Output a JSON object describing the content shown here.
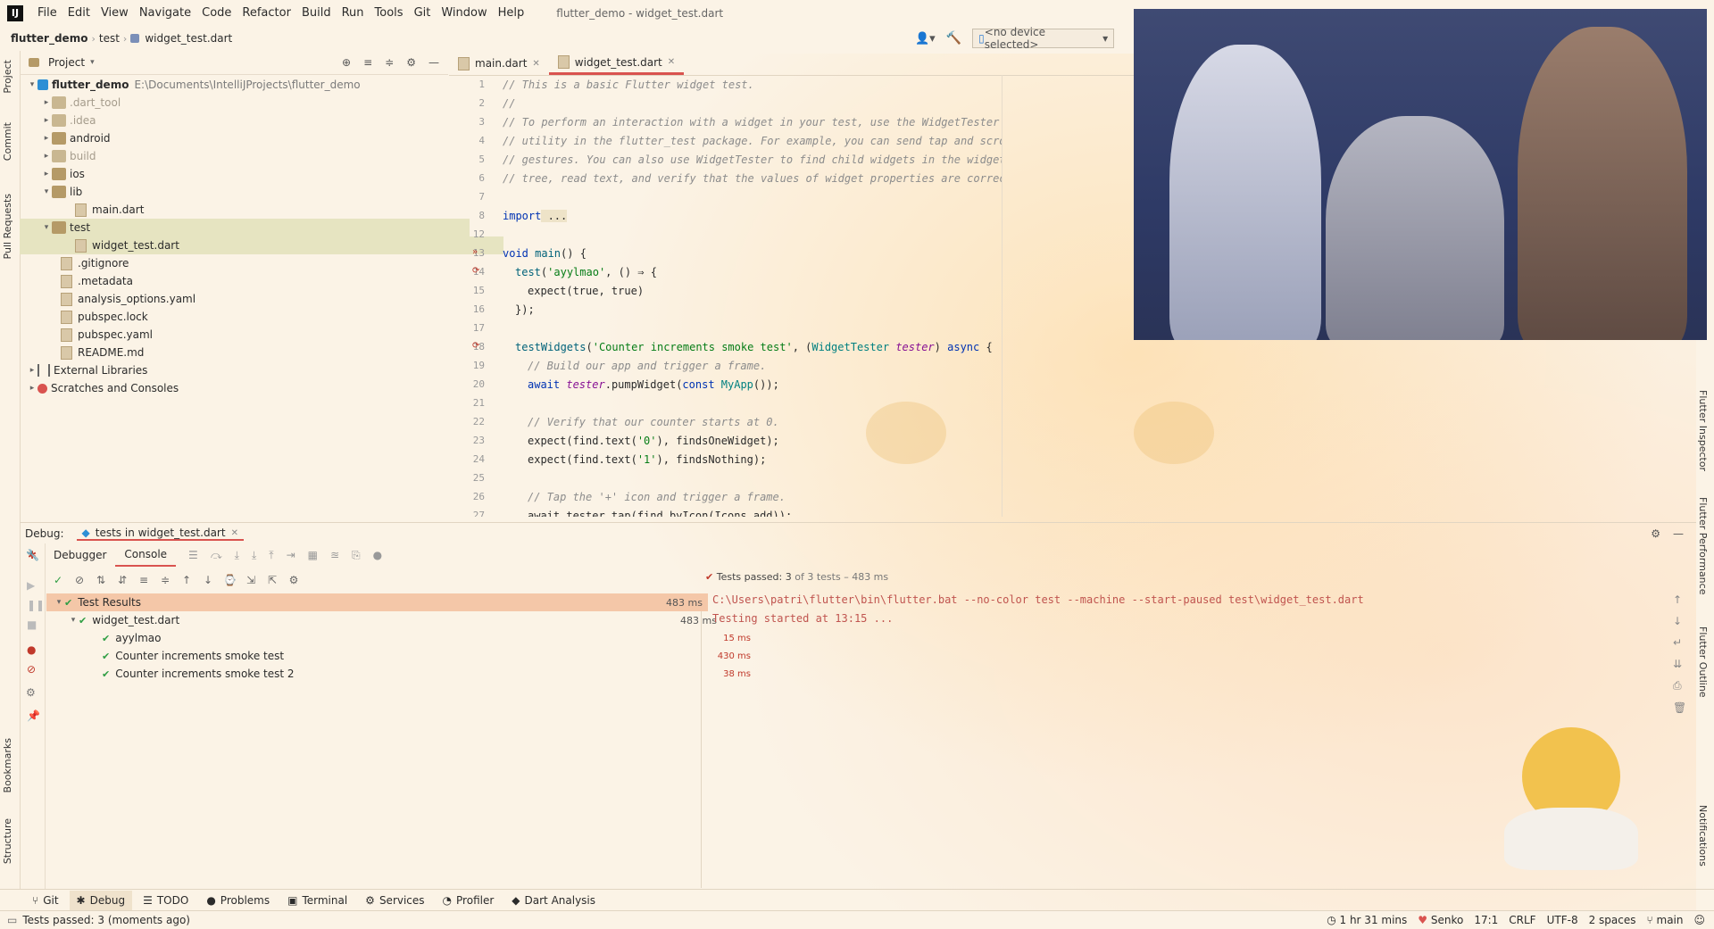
{
  "window_title": "flutter_demo - widget_test.dart",
  "menu": [
    "File",
    "Edit",
    "View",
    "Navigate",
    "Code",
    "Refactor",
    "Build",
    "Run",
    "Tools",
    "Git",
    "Window",
    "Help"
  ],
  "breadcrumb": [
    "flutter_demo",
    "test",
    "widget_test.dart"
  ],
  "device_selector": "<no device selected>",
  "left_tabs": [
    "Project",
    "Commit",
    "Pull Requests",
    "Bookmarks",
    "Structure"
  ],
  "right_tabs": [
    "Flutter Inspector",
    "Flutter Performance",
    "Flutter Outline",
    "Notifications"
  ],
  "project_panel": {
    "title": "Project",
    "tree": [
      {
        "label": "flutter_demo",
        "path": "E:\\Documents\\IntelliJProjects\\flutter_demo",
        "kind": "root"
      },
      {
        "label": ".dart_tool",
        "kind": "folder-dim"
      },
      {
        "label": ".idea",
        "kind": "folder-dim"
      },
      {
        "label": "android",
        "kind": "folder"
      },
      {
        "label": "build",
        "kind": "folder-dim"
      },
      {
        "label": "ios",
        "kind": "folder"
      },
      {
        "label": "lib",
        "kind": "folder-open"
      },
      {
        "label": "main.dart",
        "kind": "file"
      },
      {
        "label": "test",
        "kind": "folder-open"
      },
      {
        "label": "widget_test.dart",
        "kind": "file"
      },
      {
        "label": ".gitignore",
        "kind": "file"
      },
      {
        "label": ".metadata",
        "kind": "file"
      },
      {
        "label": "analysis_options.yaml",
        "kind": "file"
      },
      {
        "label": "pubspec.lock",
        "kind": "file"
      },
      {
        "label": "pubspec.yaml",
        "kind": "file"
      },
      {
        "label": "README.md",
        "kind": "file"
      },
      {
        "label": "External Libraries",
        "kind": "lib"
      },
      {
        "label": "Scratches and Consoles",
        "kind": "scratch"
      }
    ]
  },
  "editor": {
    "tabs": [
      "main.dart",
      "widget_test.dart"
    ],
    "active_tab": "widget_test.dart",
    "line_numbers": [
      "1",
      "2",
      "3",
      "4",
      "5",
      "6",
      "7",
      "8",
      "12",
      "13",
      "14",
      "15",
      "16",
      "17",
      "18",
      "19",
      "20",
      "21",
      "22",
      "23",
      "24",
      "25",
      "26",
      "27"
    ],
    "lines": {
      "l1": "// This is a basic Flutter widget test.",
      "l2": "//",
      "l3": "// To perform an interaction with a widget in your test, use the WidgetTester",
      "l4": "// utility in the flutter_test package. For example, you can send tap and scroll",
      "l5": "// gestures. You can also use WidgetTester to find child widgets in the widget",
      "l6": "// tree, read text, and verify that the values of widget properties are correct.",
      "l8_kw": "import",
      "l8_rest": " ...",
      "l13_kw": "void",
      "l13_fn": " main",
      "l13_rest": "() {",
      "l14_fn": "test",
      "l14_str": "'ayylmao'",
      "l14_rest": ", () ⇒ {",
      "l15": "expect(true, true)",
      "l16": "});",
      "l18_fn": "testWidgets",
      "l18_str": "'Counter increments smoke test'",
      "l18_cls": "WidgetTester",
      "l18_prm": "tester",
      "l18_kw": "async",
      "l19": "// Build our app and trigger a frame.",
      "l20_kw": "await",
      "l20_prm": "tester",
      "l20_mid": ".pumpWidget(",
      "l20_kw2": "const",
      "l20_cls": "MyApp",
      "l20_end": "());",
      "l22": "// Verify that our counter starts at 0.",
      "l23_a": "expect(find.text(",
      "l23_str": "'0'",
      "l23_b": "), findsOneWidget);",
      "l24_a": "expect(find.text(",
      "l24_str": "'1'",
      "l24_b": "), findsNothing);",
      "l26": "// Tap the '+' icon and trigger a frame.",
      "l27": "await tester.tap(find.byIcon(Icons.add));"
    }
  },
  "debug": {
    "label": "Debug:",
    "session_tab": "tests in widget_test.dart",
    "tabs": [
      "Debugger",
      "Console"
    ],
    "status_prefix": "Tests passed:",
    "status_count": "3",
    "status_suffix": "of 3 tests – 483 ms",
    "results": [
      {
        "label": "Test Results",
        "time": "483 ms",
        "level": 0
      },
      {
        "label": "widget_test.dart",
        "time": "483 ms",
        "level": 1
      },
      {
        "label": "ayylmao",
        "time": "15 ms",
        "level": 2
      },
      {
        "label": "Counter increments smoke test",
        "time": "430 ms",
        "level": 2
      },
      {
        "label": "Counter increments smoke test 2",
        "time": "38 ms",
        "level": 2
      }
    ],
    "console_lines": [
      "C:\\Users\\patri\\flutter\\bin\\flutter.bat --no-color test --machine --start-paused test\\widget_test.dart",
      "Testing started at 13:15 ..."
    ]
  },
  "bottom_tools": [
    "Git",
    "Debug",
    "TODO",
    "Problems",
    "Terminal",
    "Services",
    "Profiler",
    "Dart Analysis"
  ],
  "statusbar": {
    "message": "Tests passed: 3 (moments ago)",
    "timer": "1 hr 31 mins",
    "user": "Senko",
    "position": "17:1",
    "line_sep": "CRLF",
    "encoding": "UTF-8",
    "indent": "2 spaces",
    "branch": "main"
  },
  "colors": {
    "accent": "#d9534f",
    "pass": "#2f9e44",
    "background": "#fbf3e6"
  }
}
